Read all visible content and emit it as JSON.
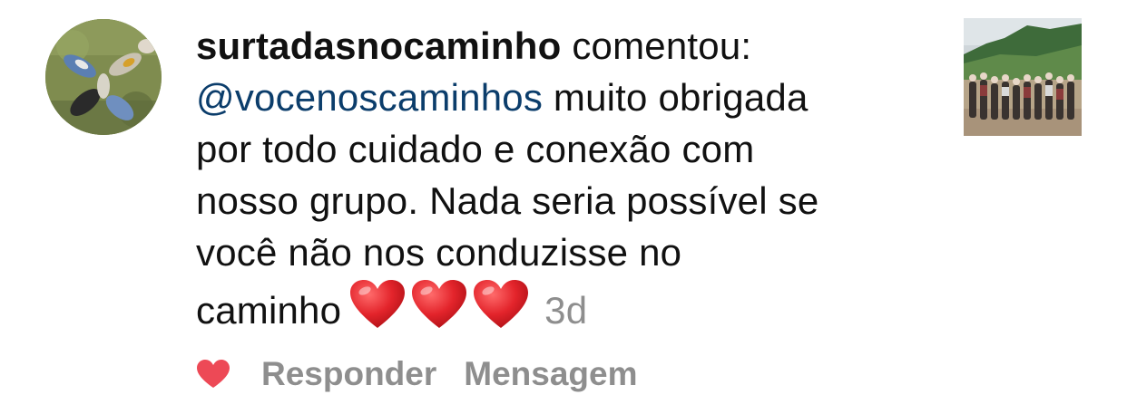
{
  "notification": {
    "username": "surtadasnocaminho",
    "action": " comentou:",
    "mention": "@vocenoscaminhos",
    "comment_lines": [
      " muito obrigada",
      "por todo cuidado e conexão com",
      "nosso grupo. Nada seria possível se",
      "você não nos conduzisse no",
      "caminho"
    ],
    "hearts": [
      "red-heart-icon",
      "red-heart-icon",
      "red-heart-icon"
    ],
    "timestamp": "3d",
    "avatar_icon": "profile-photo",
    "thumbnail_icon": "group-hiking-photo"
  },
  "actions": {
    "like_icon": "heart-filled-icon",
    "reply_label": "Responder",
    "message_label": "Mensagem"
  },
  "colors": {
    "mention": "#0b3d6b",
    "muted": "#8e8e8e",
    "heart": "#ed4956",
    "text": "#111111"
  }
}
